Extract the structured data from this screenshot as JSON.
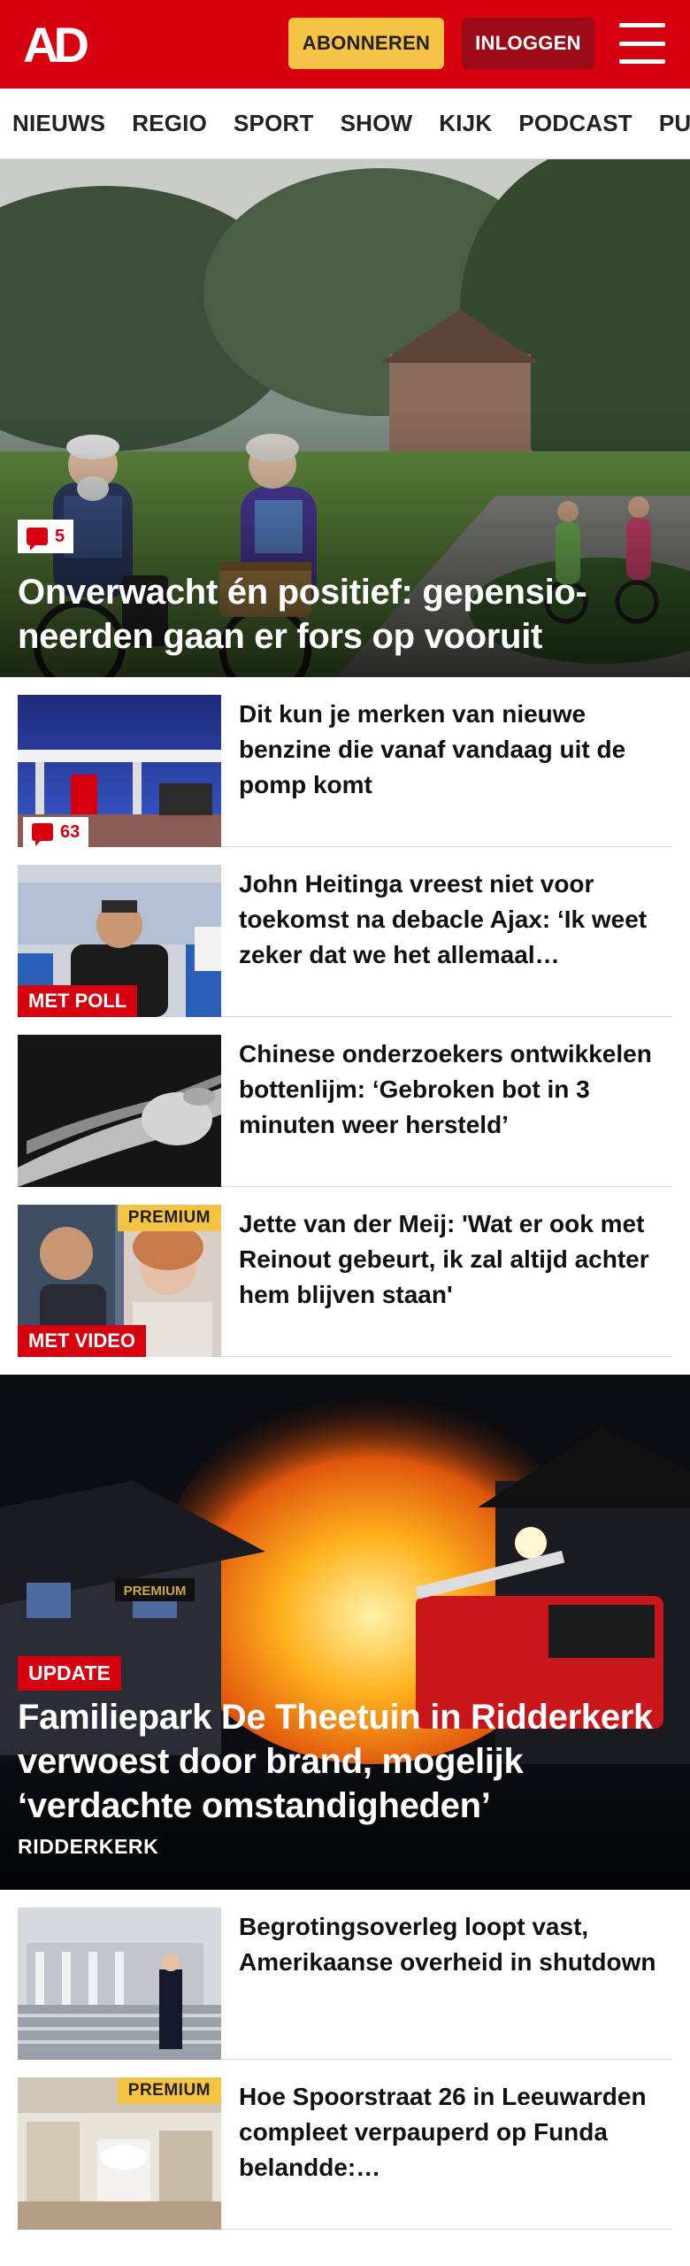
{
  "header": {
    "logo_text": "AD",
    "subscribe_label": "ABONNEREN",
    "login_label": "INLOGGEN",
    "menu_icon": "hamburger-icon",
    "brand_color": "#d7000f"
  },
  "nav": {
    "items": [
      "NIEUWS",
      "REGIO",
      "SPORT",
      "SHOW",
      "KIJK",
      "PODCAST",
      "PUZZ"
    ]
  },
  "hero": {
    "comments": "5",
    "title": "Onverwacht én positief: gepensio­neerden gaan er fors op vooruit"
  },
  "articles": [
    {
      "headline": "Dit kun je merken van nieuwe benzine die vanaf vandaag uit de pomp komt",
      "comments": "63"
    },
    {
      "headline": "John Heitinga vreest niet voor toekomst na debacle Ajax: ‘Ik weet zeker dat we het allemaal…",
      "label": "MET POLL"
    },
    {
      "headline": "Chinese onderzoekers ontwikke­len bottenlijm: ‘Gebroken bot in 3 minuten weer hersteld’"
    },
    {
      "headline": "Jette van der Meij: 'Wat er ook met Reinout gebeurt, ik zal altijd achter hem blijven staan'",
      "label": "MET VIDEO",
      "premium": "PREMIUM"
    }
  ],
  "feature": {
    "badge": "UPDATE",
    "title": "Familiepark De Theetuin in Ridderkerk verwoest door brand, mogelijk ‘verdachte omstandigheden’",
    "region": "RIDDERKERK",
    "sign_text": "PREMIUM"
  },
  "articles2": [
    {
      "headline": "Begrotingsoverleg loopt vast, Amerikaanse overheid in shutdown"
    },
    {
      "headline": "Hoe Spoorstraat 26 in Leeuwarden compleet verpauperd op Funda belandde:…",
      "premium": "PREMIUM"
    }
  ]
}
